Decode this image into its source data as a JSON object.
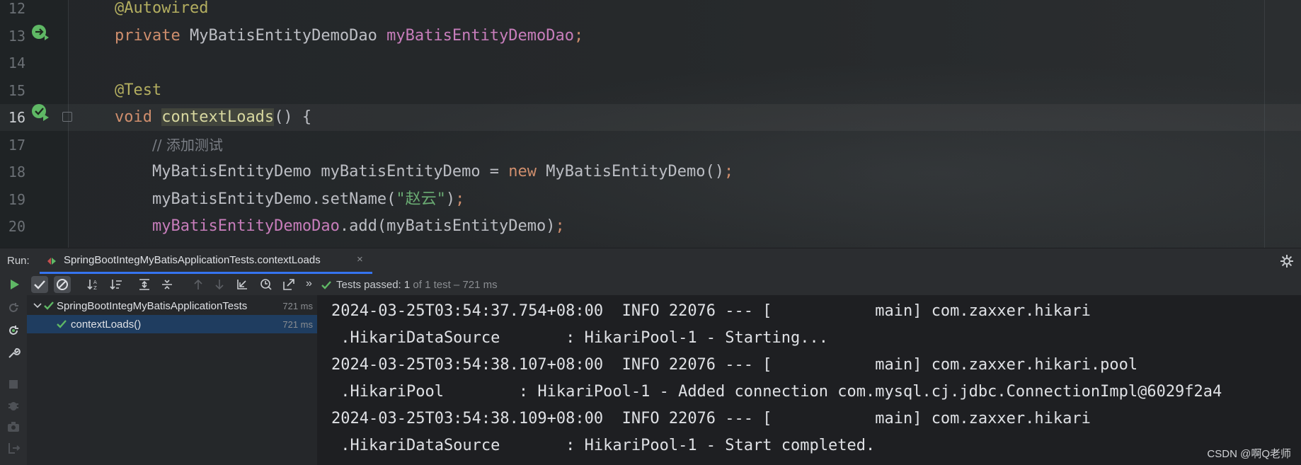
{
  "editor": {
    "lines": [
      {
        "num": "12",
        "tokens": [
          {
            "t": "@Autowired",
            "c": "ann"
          }
        ]
      },
      {
        "num": "13",
        "tokens": [
          {
            "t": "private ",
            "c": "kw"
          },
          {
            "t": "MyBatisEntityDemoDao ",
            "c": ""
          },
          {
            "t": "myBatisEntityDemoDao",
            "c": "fld"
          },
          {
            "t": ";",
            "c": "kw"
          }
        ]
      },
      {
        "num": "14",
        "tokens": []
      },
      {
        "num": "15",
        "tokens": [
          {
            "t": "@Test",
            "c": "ann"
          }
        ]
      },
      {
        "num": "16",
        "tokens": [
          {
            "t": "void ",
            "c": "kw"
          },
          {
            "t": "contextLoads",
            "c": "meth-hl"
          },
          {
            "t": "() {",
            "c": ""
          }
        ]
      },
      {
        "num": "17",
        "tokens": [
          {
            "t": "    ",
            "c": ""
          },
          {
            "t": "// 添加测试",
            "c": "cmt"
          }
        ]
      },
      {
        "num": "18",
        "tokens": [
          {
            "t": "    MyBatisEntityDemo myBatisEntityDemo = ",
            "c": ""
          },
          {
            "t": "new ",
            "c": "kw"
          },
          {
            "t": "MyBatisEntityDemo()",
            "c": ""
          },
          {
            "t": ";",
            "c": "kw"
          }
        ]
      },
      {
        "num": "19",
        "tokens": [
          {
            "t": "    myBatisEntityDemo.setName(",
            "c": ""
          },
          {
            "t": "\"赵云\"",
            "c": "str"
          },
          {
            "t": ")",
            "c": ""
          },
          {
            "t": ";",
            "c": "kw"
          }
        ]
      },
      {
        "num": "20",
        "tokens": [
          {
            "t": "    ",
            "c": ""
          },
          {
            "t": "myBatisEntityDemoDao",
            "c": "fld"
          },
          {
            "t": ".add(myBatisEntityDemo)",
            "c": ""
          },
          {
            "t": ";",
            "c": "kw"
          }
        ]
      }
    ],
    "current_line": "16"
  },
  "run": {
    "label": "Run:",
    "tab_title": "SpringBootIntegMyBatisApplicationTests.contextLoads",
    "tab_close": "×",
    "tests_passed_prefix": "Tests passed: ",
    "tests_passed_count": "1",
    "tests_passed_suffix": " of 1 test – 721 ms",
    "more": "»"
  },
  "tree": {
    "root_label": "SpringBootIntegMyBatisApplicationTests",
    "root_duration": "721 ms",
    "child_label": "contextLoads()",
    "child_duration": "721 ms"
  },
  "console": {
    "lines": [
      "2024-03-25T03:54:37.754+08:00  INFO 22076 --- [           main] com.zaxxer.hikari",
      " .HikariDataSource       : HikariPool-1 - Starting...",
      "2024-03-25T03:54:38.107+08:00  INFO 22076 --- [           main] com.zaxxer.hikari.pool",
      " .HikariPool        : HikariPool-1 - Added connection com.mysql.cj.jdbc.ConnectionImpl@6029f2a4",
      "2024-03-25T03:54:38.109+08:00  INFO 22076 --- [           main] com.zaxxer.hikari",
      " .HikariDataSource       : HikariPool-1 - Start completed."
    ]
  },
  "watermark": "CSDN @啊Q老师",
  "colors": {
    "accent": "#3574f0",
    "pass_green": "#5fb865",
    "selection": "#1f3d60"
  },
  "icons": {
    "gutter_13": "bean-navigate-icon",
    "gutter_16": "run-test-icon",
    "toolbar": [
      "run-icon",
      "show-passed-icon",
      "show-ignored-icon",
      "sort-alpha-icon",
      "sort-duration-icon",
      "expand-all-icon",
      "collapse-all-icon",
      "prev-test-icon",
      "next-test-icon",
      "import-tests-icon",
      "history-icon",
      "export-icon"
    ]
  }
}
